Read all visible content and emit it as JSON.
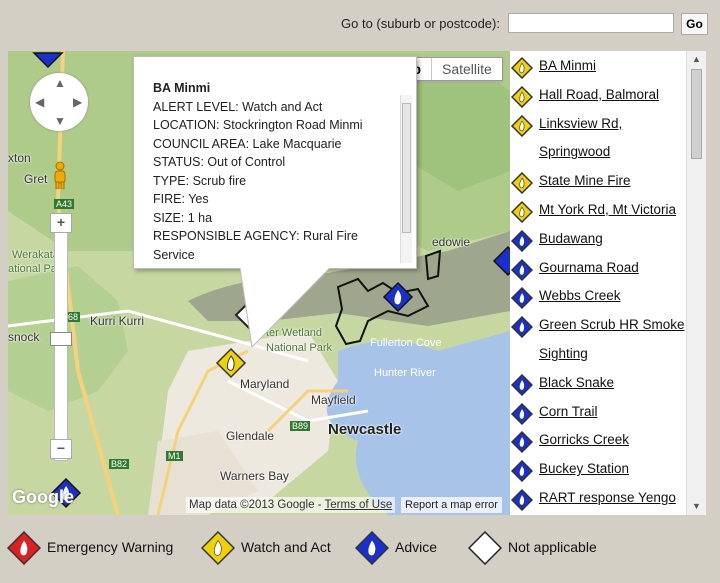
{
  "search": {
    "label": "Go to (suburb or postcode):",
    "value": "",
    "placeholder": "",
    "button": "Go"
  },
  "map": {
    "type_options": [
      "Map",
      "Satellite"
    ],
    "type_selected": "Map",
    "places": {
      "kurri_kurri": "Kurri Kurri",
      "werakata": "Werakata",
      "national_park_w": "ational Park",
      "maryland": "Maryland",
      "mayfield": "Mayfield",
      "newcastle": "Newcastle",
      "glendale": "Glendale",
      "warners_bay": "Warners Bay",
      "fullerton_cove": "Fullerton Cove",
      "hunter_river": "Hunter River",
      "wetland": "ter Wetland",
      "national_park": "National Park",
      "kton": "xton",
      "gret": "Gret",
      "snock": "snock",
      "edowie": "edowie",
      "road_a43": "A43",
      "road_b68": "B68",
      "road_b89": "B89",
      "road_m1": "M1",
      "road_b82": "B82"
    },
    "attribution": "Map data ©2013 Google -",
    "terms": "Terms of Use",
    "report": "Report a map error",
    "logo": "Google"
  },
  "popup": {
    "title": "BA Minmi",
    "lines": [
      "ALERT LEVEL: Watch and Act",
      "LOCATION: Stockrington Road Minmi",
      "COUNCIL AREA: Lake Macquarie",
      "STATUS: Out of Control",
      "TYPE: Scrub fire",
      "FIRE: Yes",
      "SIZE: 1 ha",
      "RESPONSIBLE AGENCY: Rural Fire",
      "Service"
    ]
  },
  "incidents": [
    {
      "name": "BA Minmi",
      "level": "watch"
    },
    {
      "name": "Hall Road, Balmoral",
      "level": "watch"
    },
    {
      "name": "Linksview Rd,",
      "name2": "Springwood",
      "level": "watch"
    },
    {
      "name": "State Mine Fire",
      "level": "watch"
    },
    {
      "name": "Mt York Rd, Mt Victoria",
      "level": "watch"
    },
    {
      "name": "Budawang",
      "level": "advice"
    },
    {
      "name": "Gournama Road",
      "level": "advice"
    },
    {
      "name": "Webbs Creek",
      "level": "advice"
    },
    {
      "name": "Green Scrub HR Smoke",
      "name2": "Sighting",
      "level": "advice"
    },
    {
      "name": "Black Snake",
      "level": "advice"
    },
    {
      "name": "Corn Trail",
      "level": "advice"
    },
    {
      "name": "Gorricks Creek",
      "level": "advice"
    },
    {
      "name": "Buckey Station",
      "level": "advice"
    },
    {
      "name": "RART response Yengo",
      "level": "advice"
    }
  ],
  "legend": [
    {
      "label": "Emergency Warning",
      "level": "emergency"
    },
    {
      "label": "Watch and Act",
      "level": "watch"
    },
    {
      "label": "Advice",
      "level": "advice"
    },
    {
      "label": "Not applicable",
      "level": "na"
    }
  ],
  "colors": {
    "emergency": "#e02020",
    "watch": "#f0d200",
    "advice": "#1a2fd0",
    "na": "#ffffff",
    "background": "#d3cfc4",
    "land": "#c6d7a1",
    "water": "#a8c3e8"
  }
}
